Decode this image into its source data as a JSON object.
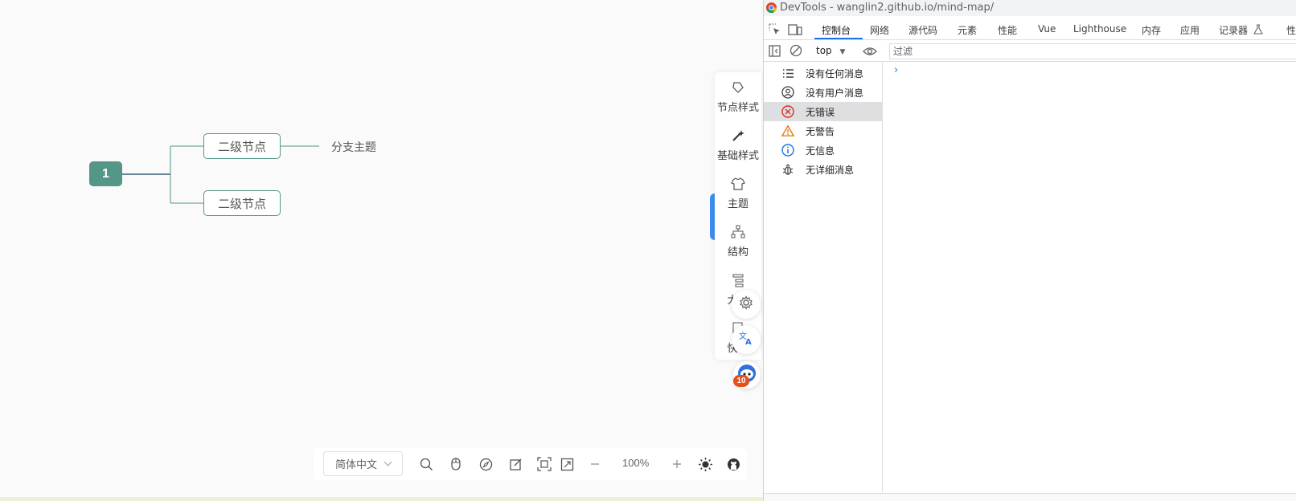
{
  "mindmap": {
    "root_label": "1",
    "children": [
      {
        "label": "二级节点"
      },
      {
        "label": "二级节点"
      }
    ],
    "branch_topic": "分支主题",
    "colors": {
      "node": "#549688",
      "line_main": "#375f7a"
    }
  },
  "side_toolbar": {
    "items": [
      {
        "label": "节点样式",
        "icon": "node-style-icon"
      },
      {
        "label": "基础样式",
        "icon": "magic-wand-icon"
      },
      {
        "label": "主题",
        "icon": "shirt-icon"
      },
      {
        "label": "结构",
        "icon": "structure-icon"
      },
      {
        "label": "大",
        "icon": "outline-icon"
      },
      {
        "label": "快",
        "icon": "shortcut-icon"
      }
    ],
    "robot_badge": "10"
  },
  "bottom_toolbar": {
    "language": "简体中文",
    "zoom": "100%"
  },
  "devtools": {
    "title": "DevTools - wanglin2.github.io/mind-map/",
    "tabs": [
      {
        "label": "控制台",
        "active": true
      },
      {
        "label": "网络"
      },
      {
        "label": "源代码"
      },
      {
        "label": "元素"
      },
      {
        "label": "性能"
      },
      {
        "label": "Vue"
      },
      {
        "label": "Lighthouse"
      },
      {
        "label": "内存"
      },
      {
        "label": "应用"
      },
      {
        "label": "记录器"
      },
      {
        "label": "性能"
      }
    ],
    "context": "top",
    "filter_placeholder": "过滤",
    "sidebar": [
      {
        "label": "没有任何消息",
        "icon": "list-icon"
      },
      {
        "label": "没有用户消息",
        "icon": "user-icon"
      },
      {
        "label": "无错误",
        "icon": "error-icon",
        "selected": true
      },
      {
        "label": "无警告",
        "icon": "warning-icon"
      },
      {
        "label": "无信息",
        "icon": "info-icon"
      },
      {
        "label": "无详细消息",
        "icon": "bug-icon"
      }
    ],
    "prompt": "›",
    "colors": {
      "accent": "#1a73e8",
      "error": "#d93025",
      "warning": "#e37400"
    }
  }
}
